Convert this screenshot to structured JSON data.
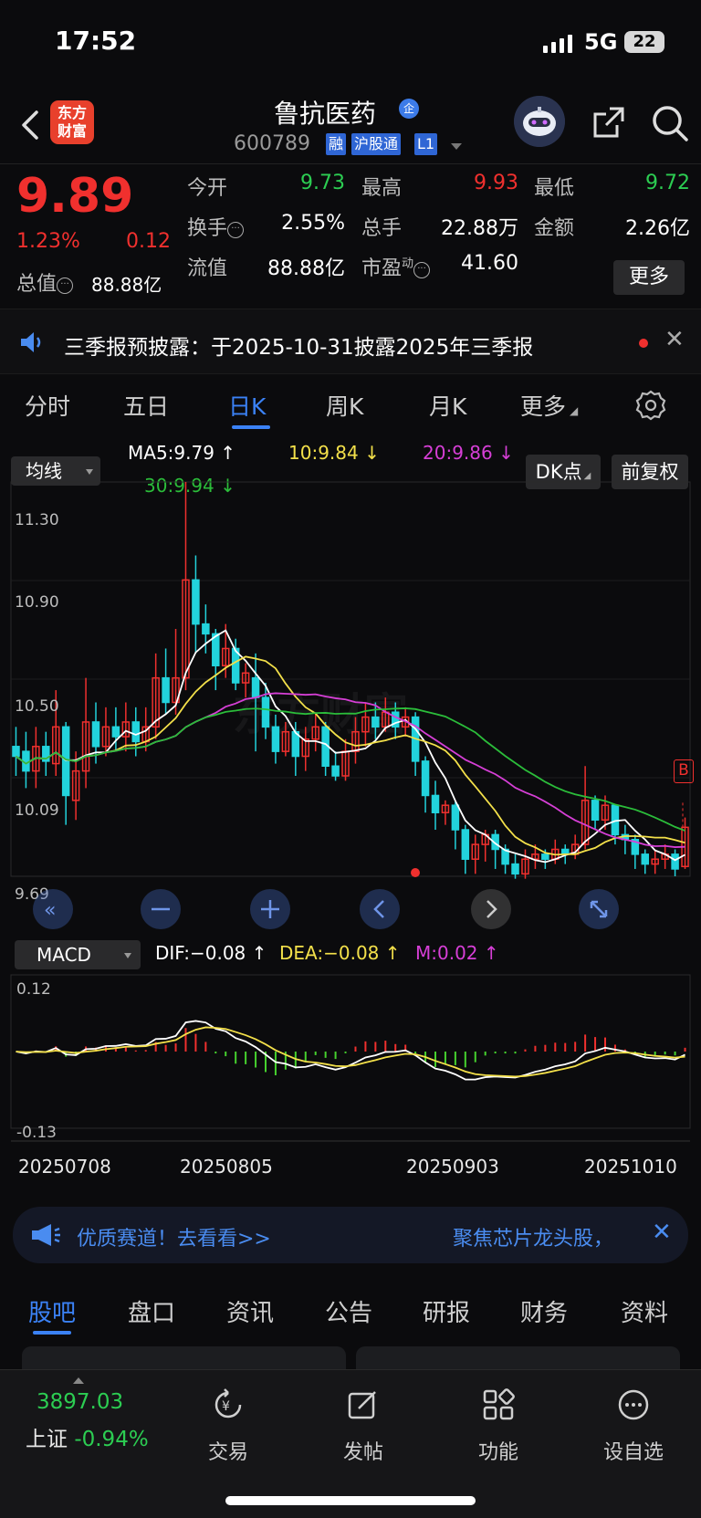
{
  "status": {
    "time": "17:52",
    "network": "5G",
    "battery": "22"
  },
  "header": {
    "logo_text": "东方财富",
    "stock_name": "鲁抗医药",
    "qi_badge": "企",
    "code": "600789",
    "tags": [
      "融",
      "沪股通",
      "L1"
    ],
    "icons": [
      "back-icon",
      "robot-avatar-icon",
      "share-icon",
      "search-icon"
    ]
  },
  "quote": {
    "price": "9.89",
    "change_pct": "1.23%",
    "change": "0.12",
    "total_value_label": "总值",
    "total_value": "88.88亿",
    "rows": [
      [
        {
          "label": "今开",
          "value": "9.73",
          "color": "#2ccd52"
        },
        {
          "label": "最高",
          "value": "9.93",
          "color": "#f0302e"
        },
        {
          "label": "最低",
          "value": "9.72",
          "color": "#2ccd52"
        }
      ],
      [
        {
          "label": "换手",
          "value": "2.55%",
          "color": "#ffffff"
        },
        {
          "label": "总手",
          "value": "22.88万",
          "color": "#ffffff"
        },
        {
          "label": "金额",
          "value": "2.26亿",
          "color": "#ffffff"
        }
      ],
      [
        {
          "label": "流值",
          "value": "88.88亿",
          "color": "#ffffff"
        },
        {
          "label": "市盈",
          "sup": "动",
          "value": "41.60",
          "color": "#ffffff"
        }
      ]
    ],
    "more_label": "更多"
  },
  "notice": {
    "text": "三季报预披露：于2025-10-31披露2025年三季报"
  },
  "period_tabs": [
    "分时",
    "五日",
    "日K",
    "周K",
    "月K",
    "更多"
  ],
  "period_active": 2,
  "chart": {
    "ma_button": "均线",
    "ma_values": [
      {
        "label": "MA5:9.79 ↑",
        "color": "#ffffff"
      },
      {
        "label": "10:9.84 ↓",
        "color": "#f3e04a"
      },
      {
        "label": "20:9.86 ↓",
        "color": "#d63fd6"
      },
      {
        "label": "30:9.94 ↓",
        "color": "#2bbd3a"
      }
    ],
    "dk_button": "DK点",
    "fq_button": "前复权",
    "y_labels": [
      "11.30",
      "10.90",
      "10.50",
      "10.09",
      "9.69"
    ],
    "b_marker": "B",
    "watermark": "东方财富",
    "macd_button": "MACD",
    "macd_values": [
      {
        "label": "DIF:−0.08 ↑",
        "color": "#ffffff"
      },
      {
        "label": "DEA:−0.08 ↑",
        "color": "#f3e04a"
      },
      {
        "label": "M:0.02 ↑",
        "color": "#d63fd6"
      }
    ],
    "macd_y_labels": [
      "0.12",
      "-0.13"
    ],
    "dates": [
      "20250708",
      "20250805",
      "20250903",
      "20251010"
    ],
    "colors": {
      "up": "#f0302e",
      "down": "#22d3dc",
      "ma5": "#ffffff",
      "ma10": "#f3e04a",
      "ma20": "#d63fd6",
      "ma30": "#2bbd3a"
    }
  },
  "chart_data": {
    "type": "candlestick",
    "ylim": [
      9.69,
      11.3
    ],
    "candles": [
      [
        10.22,
        10.18,
        10.3,
        10.1
      ],
      [
        10.2,
        10.12,
        10.28,
        10.05
      ],
      [
        10.12,
        10.22,
        10.3,
        10.05
      ],
      [
        10.22,
        10.16,
        10.28,
        10.1
      ],
      [
        10.15,
        10.3,
        10.45,
        10.1
      ],
      [
        10.3,
        10.02,
        10.32,
        9.9
      ],
      [
        10.0,
        10.12,
        10.2,
        9.92
      ],
      [
        10.12,
        10.32,
        10.5,
        10.05
      ],
      [
        10.32,
        10.22,
        10.4,
        10.15
      ],
      [
        10.22,
        10.3,
        10.38,
        10.18
      ],
      [
        10.3,
        10.26,
        10.38,
        10.2
      ],
      [
        10.26,
        10.32,
        10.4,
        10.2
      ],
      [
        10.32,
        10.24,
        10.38,
        10.18
      ],
      [
        10.24,
        10.3,
        10.38,
        10.2
      ],
      [
        10.3,
        10.5,
        10.6,
        10.25
      ],
      [
        10.5,
        10.4,
        10.62,
        10.35
      ],
      [
        10.4,
        10.5,
        10.7,
        10.35
      ],
      [
        10.5,
        10.9,
        11.3,
        10.45
      ],
      [
        10.9,
        10.72,
        11.0,
        10.6
      ],
      [
        10.72,
        10.68,
        10.8,
        10.6
      ],
      [
        10.68,
        10.55,
        10.7,
        10.45
      ],
      [
        10.55,
        10.62,
        10.72,
        10.5
      ],
      [
        10.62,
        10.48,
        10.66,
        10.45
      ],
      [
        10.48,
        10.52,
        10.56,
        10.42
      ],
      [
        10.5,
        10.42,
        10.6,
        10.2
      ],
      [
        10.42,
        10.3,
        10.48,
        10.25
      ],
      [
        10.3,
        10.2,
        10.35,
        10.15
      ],
      [
        10.2,
        10.28,
        10.32,
        10.18
      ],
      [
        10.28,
        10.18,
        10.32,
        10.1
      ],
      [
        10.18,
        10.25,
        10.3,
        10.12
      ],
      [
        10.25,
        10.3,
        10.36,
        10.2
      ],
      [
        10.3,
        10.14,
        10.32,
        10.1
      ],
      [
        10.14,
        10.1,
        10.2,
        10.08
      ],
      [
        10.1,
        10.2,
        10.25,
        10.08
      ],
      [
        10.2,
        10.28,
        10.34,
        10.15
      ],
      [
        10.28,
        10.34,
        10.4,
        10.22
      ],
      [
        10.34,
        10.3,
        10.4,
        10.25
      ],
      [
        10.3,
        10.36,
        10.42,
        10.28
      ],
      [
        10.36,
        10.3,
        10.4,
        10.25
      ],
      [
        10.3,
        10.34,
        10.38,
        10.26
      ],
      [
        10.34,
        10.16,
        10.36,
        10.1
      ],
      [
        10.16,
        10.02,
        10.18,
        9.95
      ],
      [
        10.02,
        9.95,
        10.08,
        9.88
      ],
      [
        9.95,
        9.98,
        10.0,
        9.9
      ],
      [
        9.98,
        9.88,
        10.0,
        9.8
      ],
      [
        9.88,
        9.76,
        9.9,
        9.7
      ],
      [
        9.76,
        9.82,
        9.86,
        9.7
      ],
      [
        9.82,
        9.86,
        9.88,
        9.75
      ],
      [
        9.86,
        9.8,
        9.88,
        9.72
      ],
      [
        9.8,
        9.74,
        9.82,
        9.7
      ],
      [
        9.74,
        9.7,
        9.78,
        9.68
      ],
      [
        9.7,
        9.76,
        9.8,
        9.68
      ],
      [
        9.76,
        9.78,
        9.82,
        9.72
      ],
      [
        9.78,
        9.76,
        9.8,
        9.72
      ],
      [
        9.76,
        9.8,
        9.84,
        9.74
      ],
      [
        9.8,
        9.78,
        9.82,
        9.74
      ],
      [
        9.78,
        9.82,
        9.86,
        9.76
      ],
      [
        9.82,
        10.0,
        10.14,
        9.8
      ],
      [
        10.0,
        9.92,
        10.02,
        9.88
      ],
      [
        9.92,
        9.98,
        10.02,
        9.88
      ],
      [
        9.98,
        9.86,
        9.98,
        9.82
      ],
      [
        9.86,
        9.84,
        9.9,
        9.78
      ],
      [
        9.84,
        9.78,
        9.86,
        9.72
      ],
      [
        9.78,
        9.74,
        9.8,
        9.7
      ],
      [
        9.74,
        9.76,
        9.8,
        9.7
      ],
      [
        9.76,
        9.78,
        9.82,
        9.72
      ],
      [
        9.78,
        9.72,
        9.8,
        9.69
      ],
      [
        9.73,
        9.89,
        9.93,
        9.72
      ]
    ],
    "marks": {
      "ma5_last": 9.79,
      "ma10_last": 9.84,
      "ma20_last": 9.86,
      "ma30_last": 9.94
    }
  },
  "ad": {
    "left": "优质赛道！去看看>>",
    "right": "聚焦芯片龙头股，"
  },
  "bottom_tabs": [
    "股吧",
    "盘口",
    "资讯",
    "公告",
    "研报",
    "财务",
    "资料"
  ],
  "index": {
    "value": "3897.03",
    "name": "上证",
    "change": "-0.94%"
  },
  "nav": [
    {
      "label": "交易",
      "icon": "trade-icon"
    },
    {
      "label": "发帖",
      "icon": "post-icon"
    },
    {
      "label": "功能",
      "icon": "function-icon"
    },
    {
      "label": "设自选",
      "icon": "watchlist-icon"
    }
  ]
}
